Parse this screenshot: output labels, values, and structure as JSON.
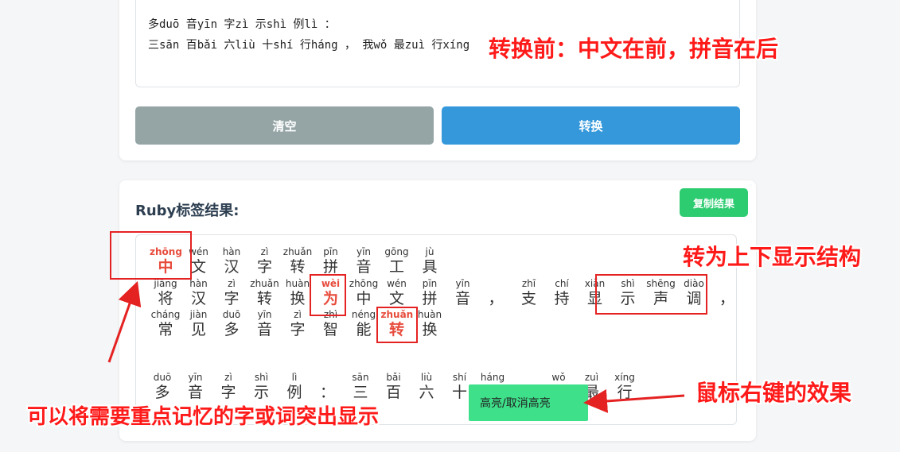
{
  "input": {
    "line1": "多duō 音yīn 字zì 示shì 例lì ：",
    "line2": "三sān 百bǎi 六liù 十shí 行háng ， 我wǒ 最zuì 行xíng"
  },
  "buttons": {
    "clear": "清空",
    "convert": "转换"
  },
  "result": {
    "title": "Ruby标签结果:",
    "copy_label": "复制结果",
    "rows": [
      [
        {
          "py": "zhōng",
          "hz": "中",
          "hl": true
        },
        {
          "py": "wén",
          "hz": "文"
        },
        {
          "py": "hàn",
          "hz": "汉"
        },
        {
          "py": "zì",
          "hz": "字"
        },
        {
          "py": "zhuǎn",
          "hz": "转"
        },
        {
          "py": "pīn",
          "hz": "拼"
        },
        {
          "py": "yīn",
          "hz": "音"
        },
        {
          "py": "gōng",
          "hz": "工"
        },
        {
          "py": "jù",
          "hz": "具"
        }
      ],
      [
        {
          "py": "jiāng",
          "hz": "将"
        },
        {
          "py": "hàn",
          "hz": "汉"
        },
        {
          "py": "zì",
          "hz": "字"
        },
        {
          "py": "zhuǎn",
          "hz": "转"
        },
        {
          "py": "huàn",
          "hz": "换"
        },
        {
          "py": "wèi",
          "hz": "为",
          "hl": true
        },
        {
          "py": "zhōng",
          "hz": "中"
        },
        {
          "py": "wén",
          "hz": "文"
        },
        {
          "py": "pīn",
          "hz": "拼"
        },
        {
          "py": "yīn",
          "hz": "音"
        },
        {
          "py": "",
          "hz": "，"
        },
        {
          "py": "zhī",
          "hz": "支"
        },
        {
          "py": "chí",
          "hz": "持"
        },
        {
          "py": "xiǎn",
          "hz": "显"
        },
        {
          "py": "shì",
          "hz": "示"
        },
        {
          "py": "shēng",
          "hz": "声"
        },
        {
          "py": "diào",
          "hz": "调"
        },
        {
          "py": "",
          "hz": "，"
        }
      ],
      [
        {
          "py": "cháng",
          "hz": "常"
        },
        {
          "py": "jiàn",
          "hz": "见"
        },
        {
          "py": "duō",
          "hz": "多"
        },
        {
          "py": "yīn",
          "hz": "音"
        },
        {
          "py": "zì",
          "hz": "字"
        },
        {
          "py": "zhì",
          "hz": "智"
        },
        {
          "py": "néng",
          "hz": "能"
        },
        {
          "py": "zhuǎn",
          "hz": "转",
          "hl": true
        },
        {
          "py": "huàn",
          "hz": "换"
        }
      ],
      [
        {
          "py": "duō",
          "hz": "多"
        },
        {
          "py": "yīn",
          "hz": "音"
        },
        {
          "py": "zì",
          "hz": "字"
        },
        {
          "py": "shì",
          "hz": "示"
        },
        {
          "py": "lì",
          "hz": "例"
        },
        {
          "py": "",
          "hz": "："
        },
        {
          "py": "sān",
          "hz": "三"
        },
        {
          "py": "bǎi",
          "hz": "百"
        },
        {
          "py": "liù",
          "hz": "六"
        },
        {
          "py": "shí",
          "hz": "十"
        },
        {
          "py": "háng",
          "hz": "行"
        },
        {
          "py": "",
          "hz": "，"
        },
        {
          "py": "wǒ",
          "hz": "我"
        },
        {
          "py": "zuì",
          "hz": "最"
        },
        {
          "py": "xíng",
          "hz": "行"
        }
      ]
    ]
  },
  "context_menu": {
    "item": "高亮/取消高亮"
  },
  "annotations": {
    "before": "转换前：中文在前，拼音在后",
    "structure": "转为上下显示结构",
    "right_click": "鼠标右键的效果",
    "highlight": "可以将需要重点记忆的字或词突出显示"
  },
  "colors": {
    "convert_button": "#3498db",
    "clear_button": "#95a5a6",
    "copy_button": "#2ecc71",
    "highlight": "#e74c3c",
    "annotation": "#ff1a1a"
  }
}
